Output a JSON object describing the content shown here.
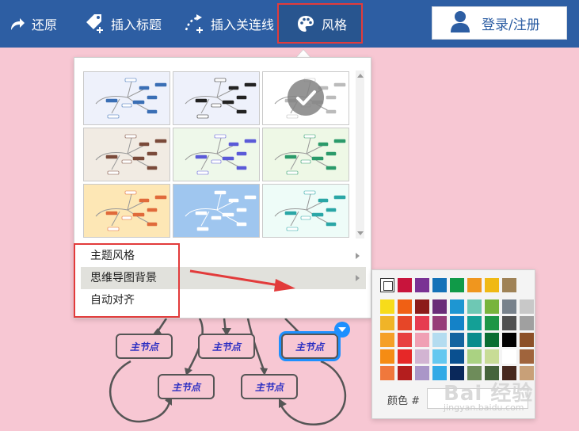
{
  "toolbar": {
    "undo_label": "还原",
    "insert_title_label": "插入标题",
    "insert_line_label": "插入关连线",
    "style_label": "风格",
    "login_label": "登录/注册"
  },
  "style_menu": {
    "items": [
      {
        "label": "主题风格"
      },
      {
        "label": "思维导图背景"
      },
      {
        "label": "自动对齐"
      }
    ],
    "theme_backgrounds": [
      "#eef1fb",
      "#eef1fb",
      "#ffffff",
      "#f1ebe3",
      "#eef8ea",
      "#eef8e6",
      "#fde7b5",
      "#9fc6ef",
      "#eefcf8"
    ]
  },
  "palette": {
    "color_label": "颜色 #",
    "color_value": "",
    "rows": [
      [
        "none",
        "#c8143c",
        "#7a3294",
        "#1472b8",
        "#109a48",
        "#f0961e",
        "#f0b914",
        "#9f8256"
      ],
      [
        "#f7dc1a",
        "#f06014",
        "#8c1c1a",
        "#6a2c78",
        "#1e96d2",
        "#6ec8b4",
        "#78b43c",
        "#78828c",
        "#c8c8c8"
      ],
      [
        "#f0b428",
        "#e64628",
        "#e63c50",
        "#963c78",
        "#1482c8",
        "#14a096",
        "#1e9646",
        "#505050",
        "#a0a0a0"
      ],
      [
        "#f5a028",
        "#e84040",
        "#f0a0b4",
        "#b4dcf0",
        "#1464a0",
        "#0a8c8c",
        "#0a6e32",
        "#000000",
        "#8c5028"
      ],
      [
        "#f58c14",
        "#e62828",
        "#d2b4d2",
        "#64c8f0",
        "#0a5090",
        "#aad282",
        "#c8dc96",
        "#ffffff",
        "#a0643c"
      ],
      [
        "#f0783c",
        "#b41e1e",
        "#aa96c8",
        "#32aae6",
        "#0a285a",
        "#6e8c5a",
        "#46643c",
        "#46281e",
        "#c8a078"
      ]
    ]
  },
  "mindmap": {
    "node_label": "主节点"
  },
  "watermark": {
    "text": "Bai 经验",
    "sub": "jingyan.baidu.com"
  }
}
